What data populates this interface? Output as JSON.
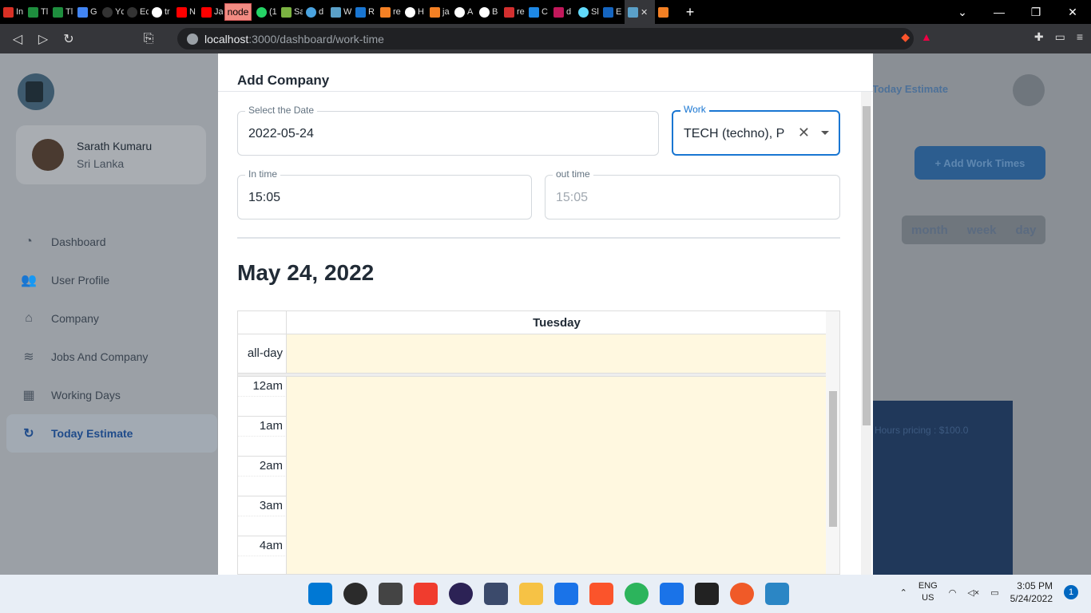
{
  "browser": {
    "tabs": [
      "In",
      "Tl",
      "Tl",
      "G",
      "Yc",
      "Ec",
      "tr",
      "N",
      "Ja",
      "node",
      "(1",
      "Sa",
      "d",
      "W",
      "R",
      "re",
      "H",
      "ja",
      "A",
      "B",
      "re",
      "C",
      "d",
      "Sl",
      "E"
    ],
    "active_tab_close": "✕",
    "new_tab": "+",
    "url_host": "localhost",
    "url_path": ":3000/dashboard/work-time",
    "colors": {
      "special_tab": "#f28b82"
    }
  },
  "sidebar": {
    "user_name": "Sarath Kumaru",
    "user_location": "Sri Lanka",
    "items": [
      {
        "label": "Dashboard",
        "icon": "pie-chart-icon"
      },
      {
        "label": "User Profile",
        "icon": "users-icon"
      },
      {
        "label": "Company",
        "icon": "home-icon"
      },
      {
        "label": "Jobs And Company",
        "icon": "layers-icon"
      },
      {
        "label": "Working Days",
        "icon": "calendar-icon"
      },
      {
        "label": "Today Estimate",
        "icon": "clock-plus-icon",
        "active": true
      }
    ]
  },
  "background": {
    "today_estimate": "Today Estimate",
    "add_work_times": "+ Add Work Times",
    "view_month": "month",
    "view_week": "week",
    "view_day": "day",
    "hours_pricing": "Hours pricing : $100.0"
  },
  "modal": {
    "title": "Add Company",
    "date_label": "Select the Date",
    "date_value": "2022-05-24",
    "work_label": "Work",
    "work_value": "TECH (techno), P",
    "in_label": "In time",
    "in_value": "15:05",
    "out_label": "out time",
    "out_value": "15:05",
    "calendar_title": "May 24, 2022",
    "day_header": "Tuesday",
    "all_day": "all-day",
    "hours": [
      "12am",
      "1am",
      "2am",
      "3am",
      "4am"
    ]
  },
  "taskbar": {
    "lang": "ENG",
    "region": "US",
    "time": "3:05 PM",
    "date": "5/24/2022",
    "notifications": "1"
  }
}
